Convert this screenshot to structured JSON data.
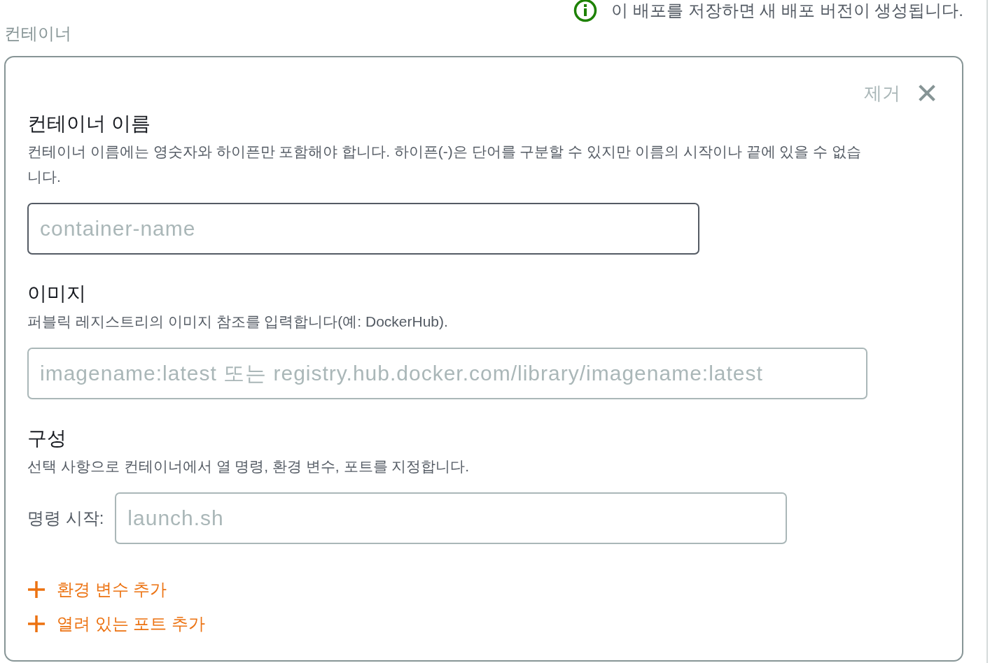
{
  "notice": {
    "text": "이 배포를 저장하면 새 배포 버전이 생성됩니다."
  },
  "section_label": "컨테이너",
  "container_card": {
    "remove_button": "제거",
    "sections": [
      {
        "heading": "컨테이너 이름",
        "description": "컨테이너 이름에는 영숫자와 하이픈만 포함해야 합니다. 하이픈(-)은 단어를 구분할 수 있지만 이름의 시작이나 끝에 있을 수 없습니다.",
        "input": {
          "placeholder": "container-name",
          "focused": true
        }
      },
      {
        "heading": "이미지",
        "description": "퍼블릭 레지스트리의 이미지 참조를 입력합니다(예: DockerHub).",
        "input": {
          "placeholder": "imagename:latest 또는 registry.hub.docker.com/library/imagename:latest",
          "focused": false
        }
      },
      {
        "heading": "구성",
        "description": "선택 사항으로 컨테이너에서 열 명령, 환경 변수, 포트를 지정합니다.",
        "input": {
          "label": "명령 시작:",
          "placeholder": "launch.sh",
          "focused": false
        }
      }
    ],
    "add_links": [
      "환경 변수 추가",
      "열려 있는 포트 추가"
    ]
  }
}
